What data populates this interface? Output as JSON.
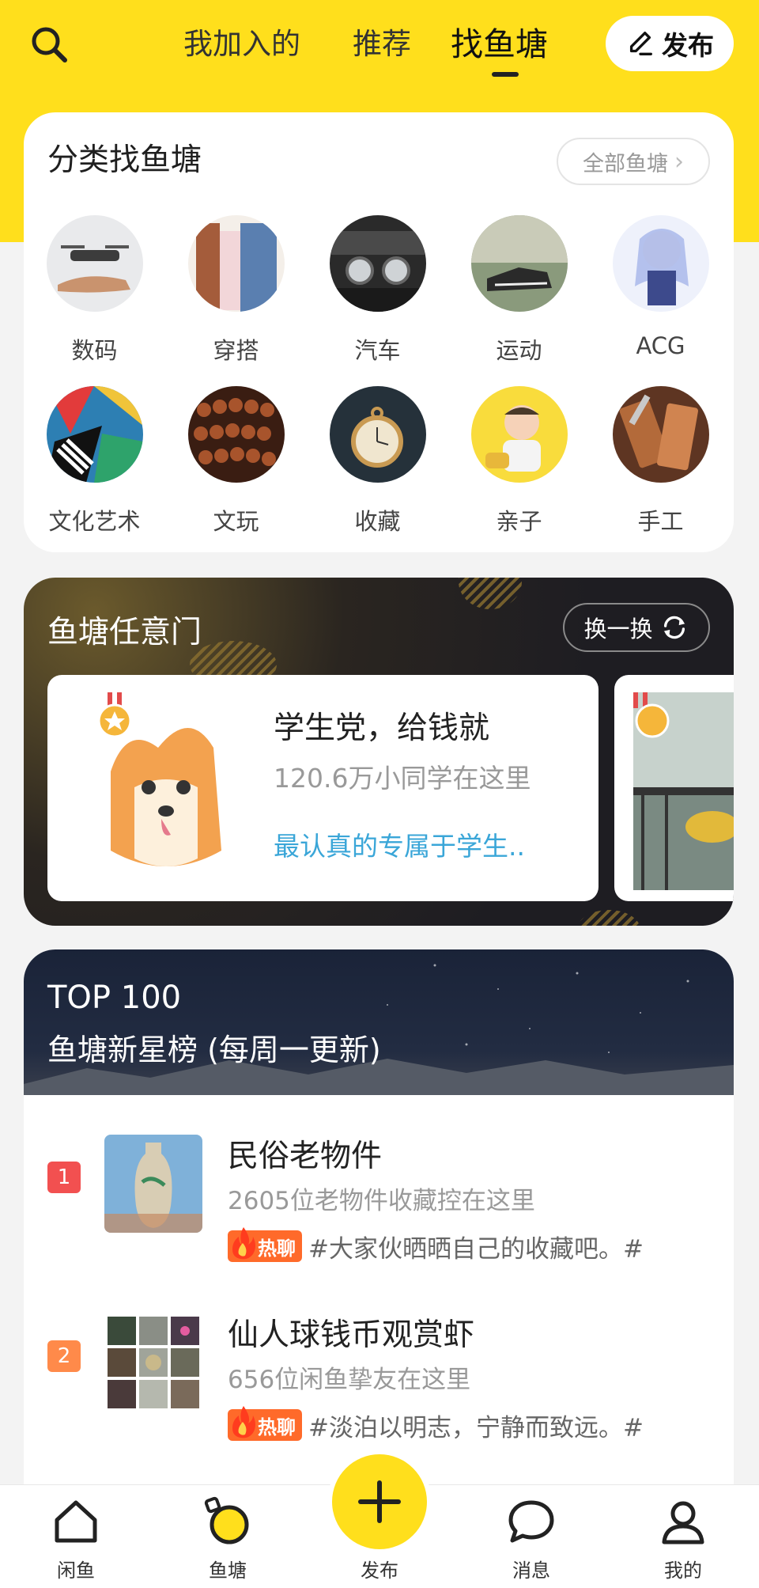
{
  "header": {
    "tabs": [
      "我加入的",
      "推荐",
      "找鱼塘"
    ],
    "active_tab": "找鱼塘",
    "publish_label": "发布",
    "accent_color": "#ffdf1c"
  },
  "categories": {
    "title": "分类找鱼塘",
    "all_label": "全部鱼塘",
    "items": [
      {
        "label": "数码",
        "icon": "drone-image"
      },
      {
        "label": "穿搭",
        "icon": "clothes-rack-image"
      },
      {
        "label": "汽车",
        "icon": "car-headlight-image"
      },
      {
        "label": "运动",
        "icon": "sneaker-image"
      },
      {
        "label": "ACG",
        "icon": "anime-girl-image"
      },
      {
        "label": "文化艺术",
        "icon": "abstract-art-image"
      },
      {
        "label": "文玩",
        "icon": "prayer-beads-image"
      },
      {
        "label": "收藏",
        "icon": "pocket-watch-image"
      },
      {
        "label": "亲子",
        "icon": "baby-image"
      },
      {
        "label": "手工",
        "icon": "leather-craft-image"
      }
    ]
  },
  "portal": {
    "title": "鱼塘任意门",
    "swap_label": "换一换",
    "cards": [
      {
        "name": "学生党，给钱就",
        "count": "120.6万小同学在这里",
        "desc": "最认真的专属于学生.."
      }
    ]
  },
  "top100": {
    "title": "TOP 100",
    "subtitle": "鱼塘新星榜 (每周一更新)",
    "items": [
      {
        "rank": "1",
        "rank_color": "#f25050",
        "name": "民俗老物件",
        "count": "2605位老物件收藏控在这里",
        "hot_label": "热聊",
        "hot_text": "#大家伙晒晒自己的收藏吧。#"
      },
      {
        "rank": "2",
        "rank_color": "#ff8a4a",
        "name": "仙人球钱币观赏虾",
        "count": "656位闲鱼挚友在这里",
        "hot_label": "热聊",
        "hot_text": "#淡泊以明志，宁静而致远。#"
      }
    ]
  },
  "bottom_nav": {
    "items": [
      {
        "label": "闲鱼",
        "icon": "home-icon"
      },
      {
        "label": "鱼塘",
        "icon": "pond-icon"
      },
      {
        "label": "发布",
        "icon": "plus-icon"
      },
      {
        "label": "消息",
        "icon": "message-icon"
      },
      {
        "label": "我的",
        "icon": "profile-icon"
      }
    ]
  }
}
